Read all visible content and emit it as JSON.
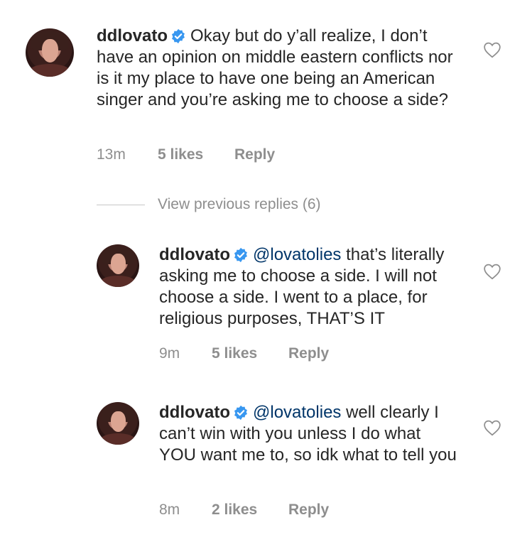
{
  "comments": [
    {
      "username": "ddlovato",
      "mention": "",
      "text": "Okay but do y’all realize, I don’t have an opinion on middle eastern conflicts nor is it my place to have one being an American singer and you’re asking me to choose a side?",
      "time": "13m",
      "likes": "5 likes",
      "reply": "Reply"
    },
    {
      "username": "ddlovato",
      "mention": "@lovatolies",
      "text": "that’s literally asking me to choose a side. I will not choose a side. I went to a place, for religious purposes, THAT’S IT",
      "time": "9m",
      "likes": "5 likes",
      "reply": "Reply"
    },
    {
      "username": "ddlovato",
      "mention": "@lovatolies",
      "text": "well clearly I can’t win with you unless I do what YOU want me to, so idk what to tell you",
      "time": "8m",
      "likes": "2 likes",
      "reply": "Reply"
    }
  ],
  "view_previous_replies": "View previous replies (6)",
  "icons": {
    "verified": "verified-badge-icon",
    "like": "heart-outline-icon"
  },
  "colors": {
    "verified": "#3897f0",
    "mention": "#003569",
    "meta": "#8e8e8e"
  }
}
